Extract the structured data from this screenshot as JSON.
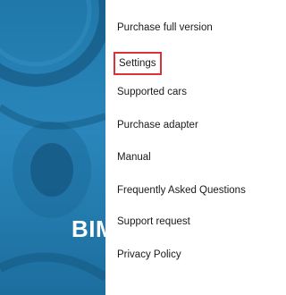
{
  "background": {
    "brand_text": "BIM",
    "accent_color": "#2a86bb"
  },
  "menu": {
    "highlight_color": "#d9323a",
    "items": [
      {
        "label": "Purchase full version"
      },
      {
        "label": "Settings",
        "highlighted": true
      },
      {
        "label": "Supported cars"
      },
      {
        "label": "Purchase adapter"
      },
      {
        "label": "Manual"
      },
      {
        "label": "Frequently Asked Questions"
      },
      {
        "label": "Support request"
      },
      {
        "label": "Privacy Policy"
      }
    ]
  }
}
